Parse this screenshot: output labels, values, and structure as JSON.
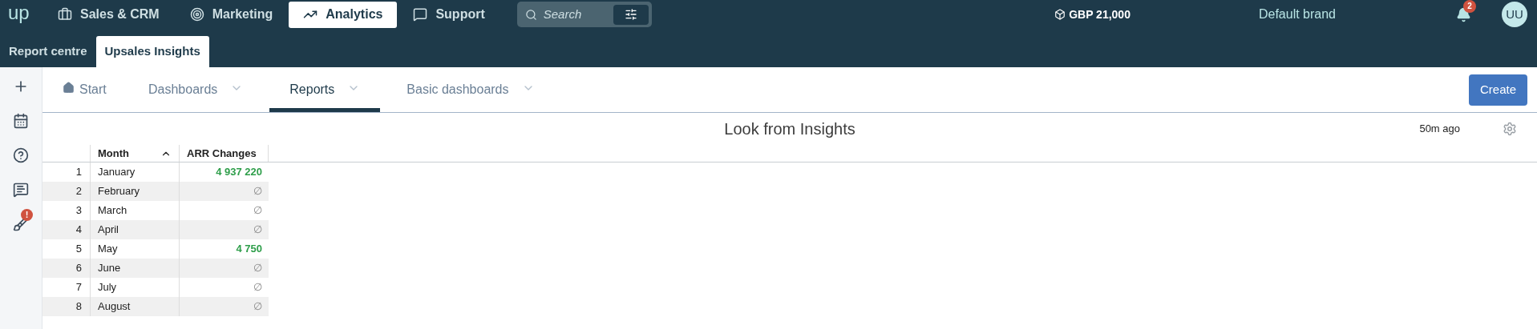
{
  "topbar": {
    "logo": "up",
    "nav": [
      {
        "label": "Sales & CRM",
        "selected": false
      },
      {
        "label": "Marketing",
        "selected": false
      },
      {
        "label": "Analytics",
        "selected": true
      },
      {
        "label": "Support",
        "selected": false
      }
    ],
    "search": {
      "placeholder": "Search"
    },
    "credits": "GBP 21,000",
    "brand": "Default brand",
    "notifications": "2",
    "avatar": "UU"
  },
  "subnav": [
    {
      "label": "Report centre",
      "selected": false
    },
    {
      "label": "Upsales Insights",
      "selected": true
    }
  ],
  "sidebar_alert": "!",
  "tabs": [
    {
      "label": "Start",
      "dropdown": false,
      "selected": false
    },
    {
      "label": "Dashboards",
      "dropdown": true,
      "selected": false
    },
    {
      "label": "Reports",
      "dropdown": true,
      "selected": true
    },
    {
      "label": "Basic dashboards",
      "dropdown": true,
      "selected": false
    }
  ],
  "create_button": "Create",
  "report": {
    "title": "Look from Insights",
    "updated": "50m ago",
    "columns": [
      {
        "label": "Month",
        "sorted": true
      },
      {
        "label": "ARR Changes",
        "sorted": false
      }
    ],
    "rows": [
      {
        "index": "1",
        "month": "January",
        "value": "4 937 220",
        "kind": "number"
      },
      {
        "index": "2",
        "month": "February",
        "value": "∅",
        "kind": "empty"
      },
      {
        "index": "3",
        "month": "March",
        "value": "∅",
        "kind": "empty"
      },
      {
        "index": "4",
        "month": "April",
        "value": "∅",
        "kind": "empty"
      },
      {
        "index": "5",
        "month": "May",
        "value": "4 750",
        "kind": "number"
      },
      {
        "index": "6",
        "month": "June",
        "value": "∅",
        "kind": "empty"
      },
      {
        "index": "7",
        "month": "July",
        "value": "∅",
        "kind": "empty"
      },
      {
        "index": "8",
        "month": "August",
        "value": "∅",
        "kind": "empty"
      }
    ]
  }
}
